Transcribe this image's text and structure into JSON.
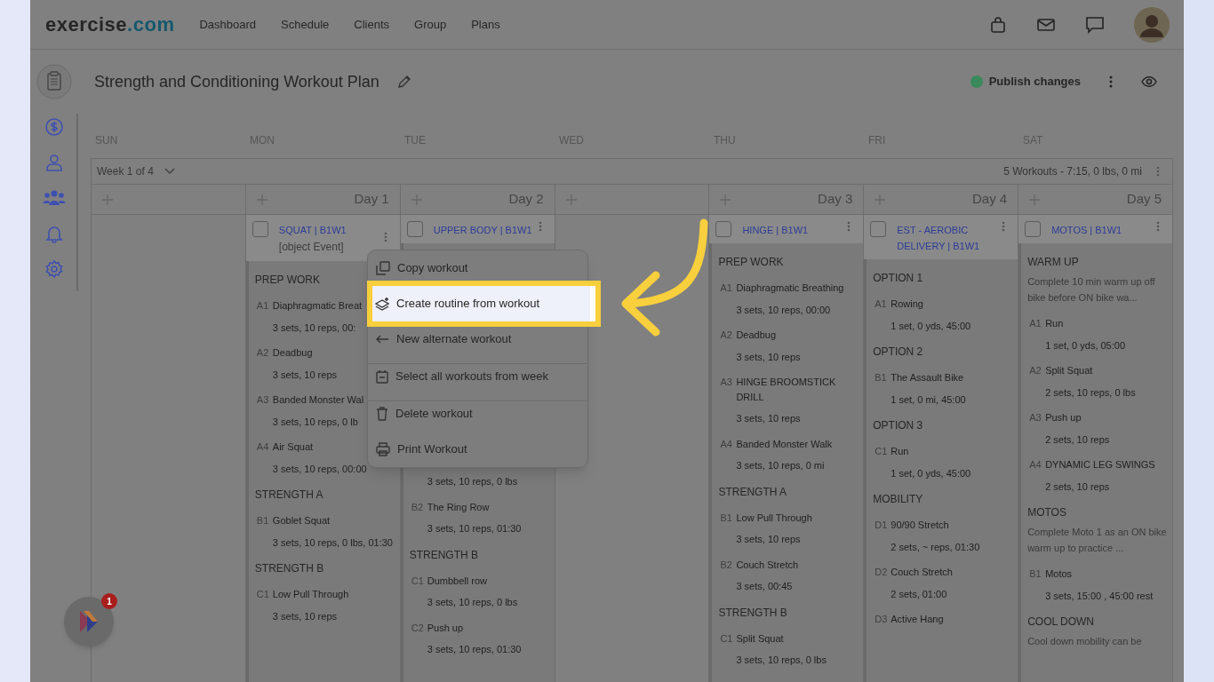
{
  "nav": {
    "brand": [
      {
        "text": "exercise",
        "kind": "main"
      },
      {
        "text": ".com",
        "kind": "accent"
      }
    ],
    "links": [
      "Dashboard",
      "Schedule",
      "Clients",
      "Group",
      "Plans"
    ]
  },
  "plan": {
    "title": "Strength and Conditioning Workout Plan",
    "publish": {
      "label": "Publish changes",
      "published": true
    }
  },
  "week": {
    "selector": "Week 1 of 4",
    "summary": "5 Workouts - 7:15, 0 lbs, 0 mi"
  },
  "columns": [
    {
      "weekday": "SUN"
    },
    {
      "weekday": "MON",
      "day": "Day 1",
      "workout": {
        "title": "SQUAT | B1W1",
        "subtitle": "[object Event]",
        "checked": false,
        "sections": [
          {
            "heading": "PREP WORK",
            "exercises": [
              {
                "code": "A1",
                "name": "Diaphragmatic Breat",
                "detail": "3 sets, 10 reps, 00:"
              },
              {
                "code": "A2",
                "name": "Deadbug",
                "detail": "3 sets, 10 reps"
              },
              {
                "code": "A3",
                "name": "Banded Monster Wal",
                "detail": "3 sets, 10 reps, 0 lb"
              },
              {
                "code": "A4",
                "name": "Air Squat",
                "detail": "3 sets, 10 reps, 00:00"
              }
            ]
          },
          {
            "heading": "STRENGTH A",
            "exercises": [
              {
                "code": "B1",
                "name": "Goblet Squat",
                "detail": "3 sets, 10 reps, 0 lbs, 01:30"
              }
            ]
          },
          {
            "heading": "STRENGTH B",
            "exercises": [
              {
                "code": "C1",
                "name": "Low Pull Through",
                "detail": "3 sets, 10 reps"
              }
            ]
          }
        ]
      }
    },
    {
      "weekday": "TUE",
      "day": "Day 2",
      "workout": {
        "title": "UPPER BODY | B1W1",
        "checked": false,
        "sections": [
          {
            "exercises": [
              {
                "detail": "3 sets, 10 reps, 0 lbs"
              },
              {
                "code": "B2",
                "name": "The Ring Row",
                "detail": "3 sets, 10 reps, 01:30"
              }
            ]
          },
          {
            "heading": "STRENGTH B",
            "exercises": [
              {
                "code": "C1",
                "name": "Dumbbell row",
                "detail": "3 sets, 10 reps, 0 lbs"
              },
              {
                "code": "C2",
                "name": "Push up",
                "detail": "3 sets, 10 reps, 01:30"
              }
            ]
          }
        ]
      }
    },
    {
      "weekday": "WED"
    },
    {
      "weekday": "THU",
      "day": "Day 3",
      "workout": {
        "title": "HINGE | B1W1",
        "checked": false,
        "sections": [
          {
            "heading": "PREP WORK",
            "exercises": [
              {
                "code": "A1",
                "name": "Diaphragmatic Breathing",
                "detail": "3 sets, 10 reps, 00:00"
              },
              {
                "code": "A2",
                "name": "Deadbug",
                "detail": "3 sets, 10 reps"
              },
              {
                "code": "A3",
                "name": "HINGE BROOMSTICK DRILL",
                "detail": "3 sets, 10 reps"
              },
              {
                "code": "A4",
                "name": "Banded Monster Walk",
                "detail": "3 sets, 10 reps, 0 mi"
              }
            ]
          },
          {
            "heading": "STRENGTH A",
            "exercises": [
              {
                "code": "B1",
                "name": "Low Pull Through",
                "detail": "3 sets, 10 reps"
              },
              {
                "code": "B2",
                "name": "Couch Stretch",
                "detail": "3 sets, 00:45"
              }
            ]
          },
          {
            "heading": "STRENGTH B",
            "exercises": [
              {
                "code": "C1",
                "name": "Split Squat",
                "detail": "3 sets, 10 reps, 0 lbs"
              }
            ]
          }
        ]
      }
    },
    {
      "weekday": "FRI",
      "day": "Day 4",
      "workout": {
        "title": "EST - AEROBIC DELIVERY | B1W1",
        "checked": false,
        "sections": [
          {
            "heading": "OPTION 1",
            "exercises": [
              {
                "code": "A1",
                "name": "Rowing",
                "detail": "1 set, 0 yds, 45:00"
              }
            ]
          },
          {
            "heading": "OPTION 2",
            "exercises": [
              {
                "code": "B1",
                "name": "The Assault Bike",
                "detail": "1 set, 0 mi, 45:00"
              }
            ]
          },
          {
            "heading": "OPTION 3",
            "exercises": [
              {
                "code": "C1",
                "name": "Run",
                "detail": "1 set, 0 yds, 45:00"
              }
            ]
          },
          {
            "heading": "MOBILITY",
            "exercises": [
              {
                "code": "D1",
                "name": "90/90 Stretch",
                "detail": "2 sets, ~ reps, 01:30"
              },
              {
                "code": "D2",
                "name": "Couch Stretch",
                "detail": "2 sets, 01:00"
              },
              {
                "code": "D3",
                "name": "Active Hang"
              }
            ]
          }
        ]
      }
    },
    {
      "weekday": "SAT",
      "day": "Day 5",
      "workout": {
        "title": "MOTOS | B1W1",
        "checked": false,
        "sections": [
          {
            "heading": "WARM UP",
            "note": "Complete 10 min warm up off bike before ON bike wa...",
            "exercises": [
              {
                "code": "A1",
                "name": "Run",
                "detail": "1 set, 0 yds, 05:00"
              },
              {
                "code": "A2",
                "name": "Split Squat",
                "detail": "2 sets, 10 reps, 0 lbs"
              },
              {
                "code": "A3",
                "name": "Push up",
                "detail": "2 sets, 10 reps"
              },
              {
                "code": "A4",
                "name": "DYNAMIC LEG SWINGS",
                "detail": "2 sets, 10 reps"
              }
            ]
          },
          {
            "heading": "MOTOS",
            "note": "Complete Moto 1 as an ON bike warm up to practice ...",
            "exercises": [
              {
                "code": "B1",
                "name": "Motos",
                "detail": "3 sets, 15:00 , 45:00 rest"
              }
            ]
          },
          {
            "heading": "COOL DOWN",
            "note": "Cool down mobility can be"
          }
        ]
      }
    }
  ],
  "menu": {
    "items": [
      {
        "label": "Copy workout",
        "kind": "copy",
        "highlighted": false
      },
      {
        "label": "Create routine from workout",
        "kind": "routine",
        "highlighted": true
      },
      {
        "label": "New alternate workout",
        "kind": "alternate",
        "highlighted": false
      },
      {
        "label": "Select all workouts from week",
        "kind": "calendar",
        "highlighted": false,
        "divider": true
      },
      {
        "label": "Delete workout",
        "kind": "trash",
        "highlighted": false,
        "divider": true
      },
      {
        "label": "Print Workout",
        "kind": "print",
        "highlighted": false
      }
    ]
  },
  "chat_badge": {
    "count": "1"
  }
}
